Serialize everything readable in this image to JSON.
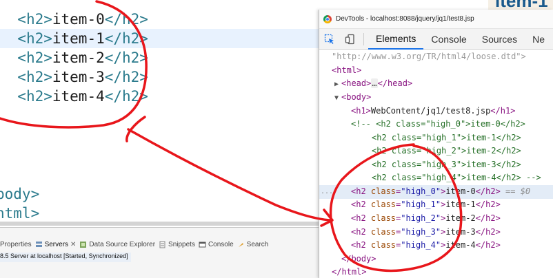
{
  "editor": {
    "lines": [
      {
        "open": "<h2>",
        "text": "item-0",
        "close": "</h2>"
      },
      {
        "open": "<h2>",
        "text": "item-1",
        "close": "</h2>"
      },
      {
        "open": "<h2>",
        "text": "item-2",
        "close": "</h2>"
      },
      {
        "open": "<h2>",
        "text": "item-3",
        "close": "</h2>"
      },
      {
        "open": "<h2>",
        "text": "item-4",
        "close": "</h2>"
      }
    ],
    "body_close": "body>",
    "html_close": "html>"
  },
  "bottom_panel": {
    "tabs": [
      {
        "label": "Properties",
        "icon": "properties-icon"
      },
      {
        "label": "Servers",
        "icon": "servers-icon"
      },
      {
        "label": "Data Source Explorer",
        "icon": "database-icon"
      },
      {
        "label": "Snippets",
        "icon": "snippets-icon"
      },
      {
        "label": "Console",
        "icon": "console-icon"
      },
      {
        "label": "Search",
        "icon": "search-icon"
      }
    ],
    "server_row": "8.5 Server at localhost  [Started, Synchronized]"
  },
  "devtools": {
    "title": "DevTools - localhost:8088/jquery/jq1/test8.jsp",
    "tabs": [
      "Elements",
      "Console",
      "Sources",
      "Ne"
    ],
    "active_tab": "Elements",
    "doctype_tail": "\"http://www.w3.org/TR/html4/loose.dtd\">",
    "html_open": "<html>",
    "head_open": "<head>",
    "head_ellipsis": "…",
    "head_close": "</head>",
    "body_open": "<body>",
    "h1_open": "<h1>",
    "h1_text": "WebContent/jq1/test8.jsp",
    "h1_close": "</h1>",
    "comment_start": "<!-- ",
    "comment_lines": [
      {
        "open": "<h2 class=\"high_0\">",
        "text": "item-0",
        "close": "</h2>"
      },
      {
        "open": "<h2 class=\"high_1\">",
        "text": "item-1",
        "close": "</h2>"
      },
      {
        "open": "<h2 class=\"high_2\">",
        "text": "item-2",
        "close": "</h2>"
      },
      {
        "open": "<h2 class=\"high_3\">",
        "text": "item-3",
        "close": "</h2>"
      },
      {
        "open": "<h2 class=\"high_4\">",
        "text": "item-4",
        "close": "</h2>"
      }
    ],
    "comment_end": " -->",
    "h2_nodes": [
      {
        "class": "high_0",
        "text": "item-0"
      },
      {
        "class": "high_1",
        "text": "item-1"
      },
      {
        "class": "high_2",
        "text": "item-2"
      },
      {
        "class": "high_3",
        "text": "item-3"
      },
      {
        "class": "high_4",
        "text": "item-4"
      }
    ],
    "selected_suffix": " == $0",
    "body_close": "</body>",
    "html_close": "</html>",
    "dots": "..."
  },
  "background_window": {
    "title_fragment": "item-1"
  },
  "colors": {
    "annotation": "#e8161b",
    "tag": "#2a7a8c",
    "selection": "#e3ecf7",
    "accent": "#1a73e8"
  }
}
